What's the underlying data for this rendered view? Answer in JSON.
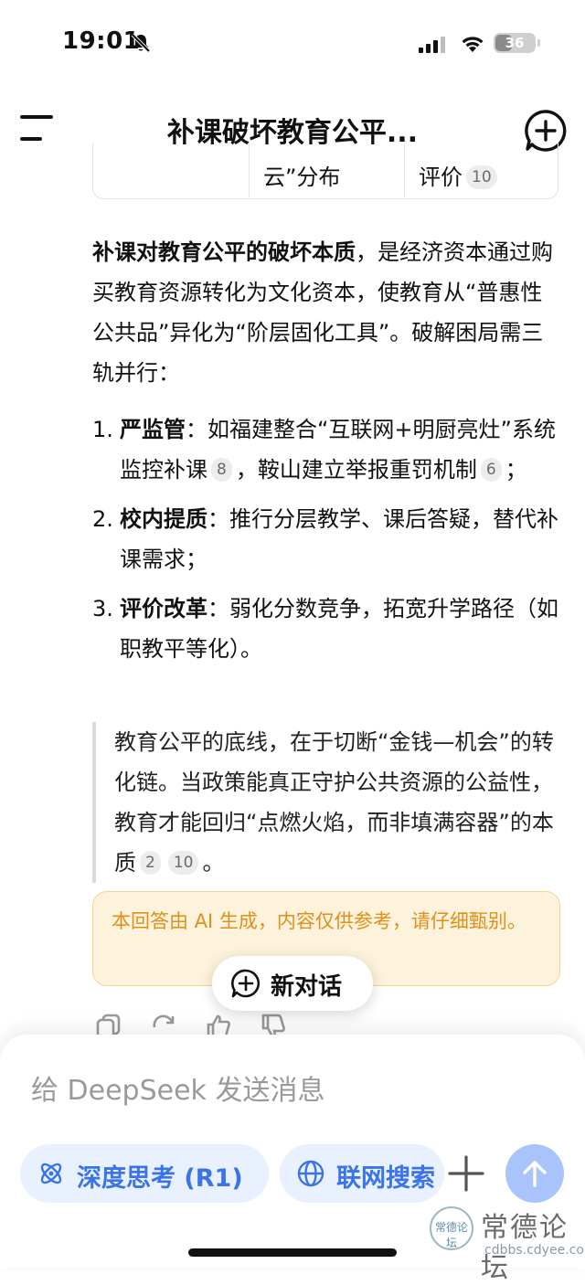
{
  "status_bar": {
    "time": "19:01",
    "battery": "36"
  },
  "header": {
    "title": "补课破坏教育公平..."
  },
  "table_tail": {
    "cell2": "云”分布",
    "cell3": "评价",
    "cell3_cite": "10"
  },
  "summary": {
    "bold": "补课对教育公平的破坏本质",
    "text": "，是经济资本通过购买教育资源转化为文化资本，使教育从“普惠性公共品”异化为“阶层固化工具”。破解困局需三轨并行："
  },
  "list": [
    {
      "num": "1.",
      "bold": "严监管",
      "text_a": "：如福建整合“互联网+明厨亮灶”系统监控补课",
      "cite_a": "8",
      "text_b": "，鞍山建立举报重罚机制",
      "cite_b": "6",
      "text_c": "；"
    },
    {
      "num": "2.",
      "bold": "校内提质",
      "text_a": "：推行分层教学、课后答疑，替代补课需求；"
    },
    {
      "num": "3.",
      "bold": "评价改革",
      "text_a": "：弱化分数竞争，拓宽升学路径（如职教平等化）。"
    }
  ],
  "quote": {
    "text": "教育公平的底线，在于切断“金钱—机会”的转化链。当政策能真正守护公共资源的公益性，教育才能回归“点燃火焰，而非填满容器”的本质",
    "cite_a": "2",
    "cite_b": "10",
    "end": "。"
  },
  "notice": {
    "text": "本回答由 AI 生成，内容仅供参考，请仔细甄别。"
  },
  "floating": {
    "new_chat_label": "新对话"
  },
  "composer": {
    "placeholder": "给 DeepSeek 发送消息",
    "deep_think_label": "深度思考 (R1)",
    "web_search_label": "联网搜索"
  },
  "watermark": {
    "logo_text": "常德论坛",
    "title": "常德论坛",
    "url": "cdbbs.cdyee.com"
  },
  "colors": {
    "accent": "#3a74e8",
    "notice_text": "#e0901a",
    "notice_bg": "#fdf3dc",
    "send_bg": "#a9c4fb"
  }
}
